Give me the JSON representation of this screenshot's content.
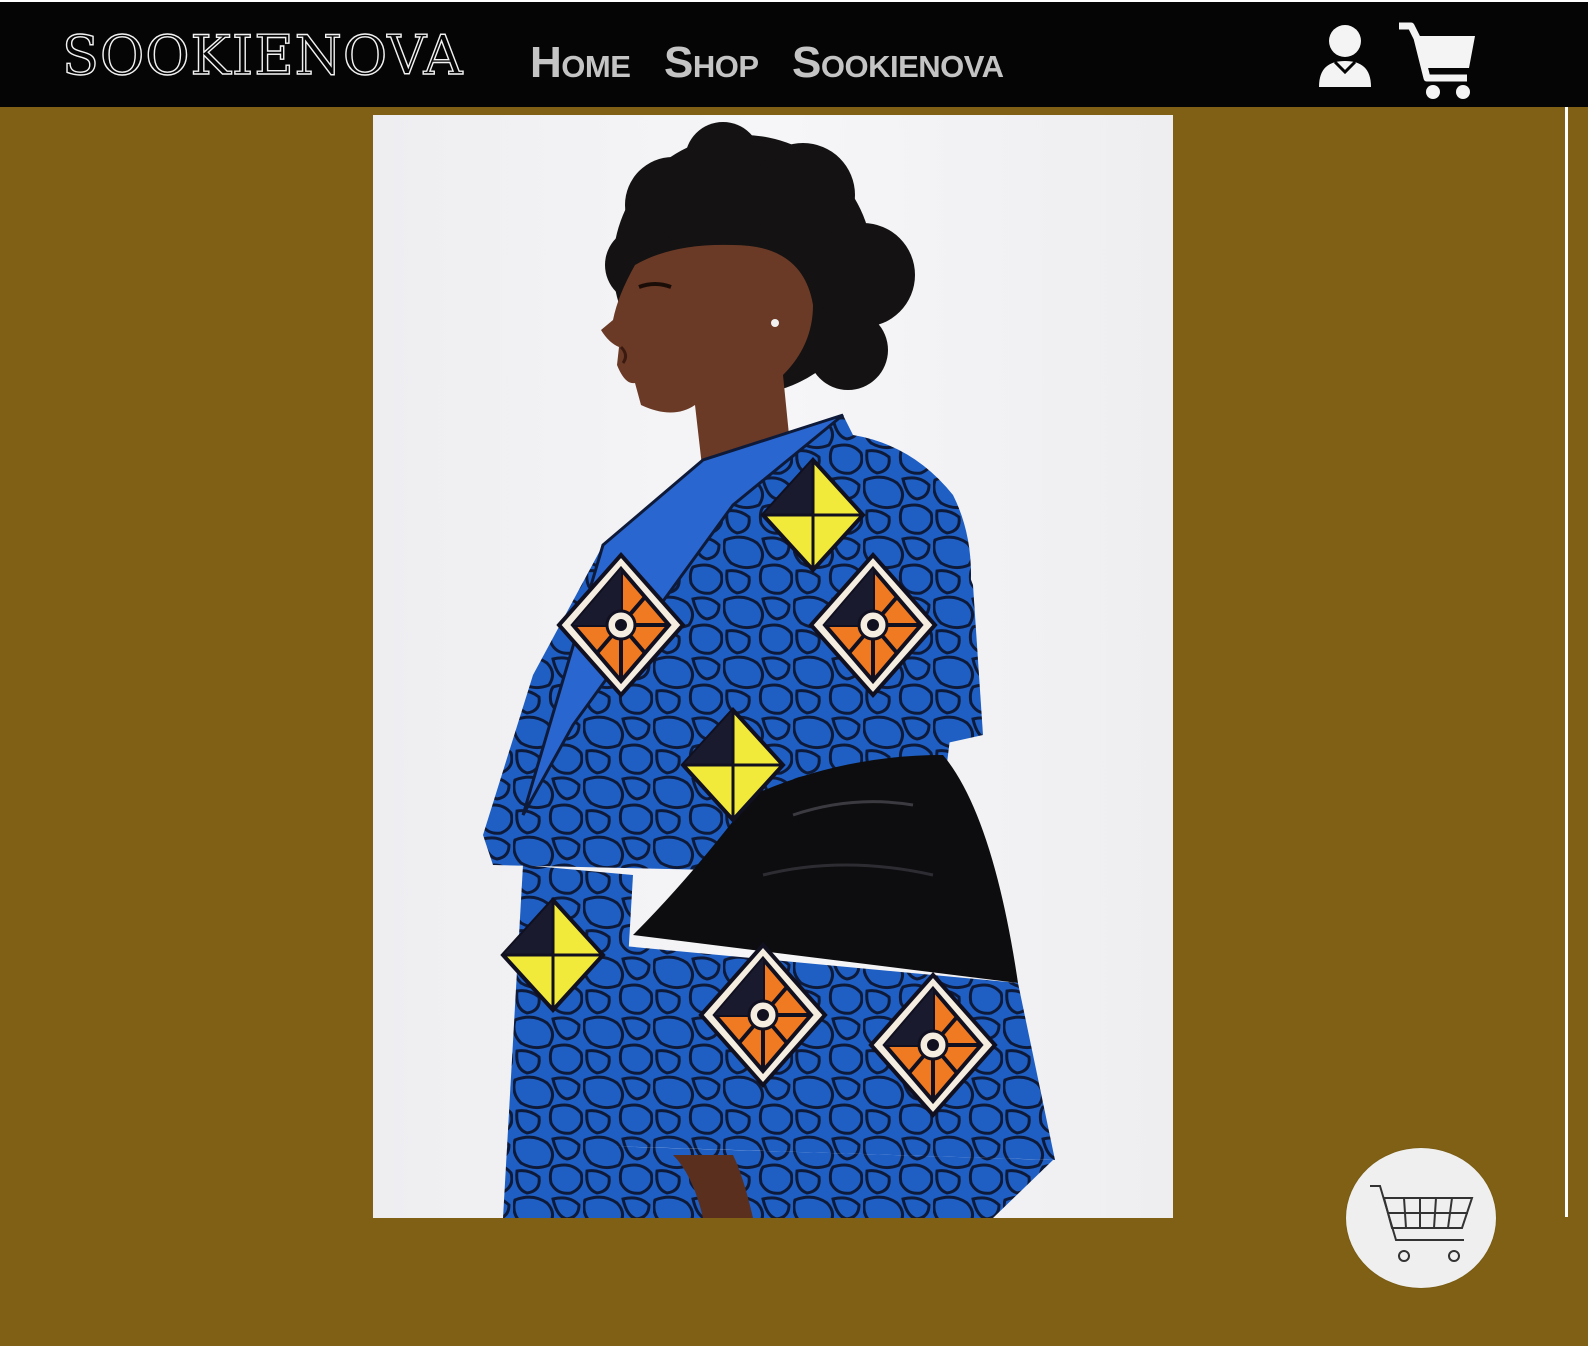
{
  "header": {
    "logo": "SOOKIENOVA",
    "nav": [
      {
        "label": "Home"
      },
      {
        "label": "Shop"
      },
      {
        "label": "Sookienova"
      }
    ],
    "icons": {
      "account": "user-icon",
      "cart": "shopping-cart-icon"
    }
  },
  "hero": {
    "image": "model-in-blue-ankara-print-jacket-with-black-ruffle-sleeves"
  },
  "floating_cart": {
    "icon": "cart-outline-icon"
  },
  "colors": {
    "header_bg": "#050505",
    "page_bg": "#7f6014",
    "nav_text": "#c4c4c4",
    "fabric_blue": "#1f5fc4",
    "fabric_orange": "#f07a22",
    "fabric_yellow": "#f2ea3a"
  }
}
